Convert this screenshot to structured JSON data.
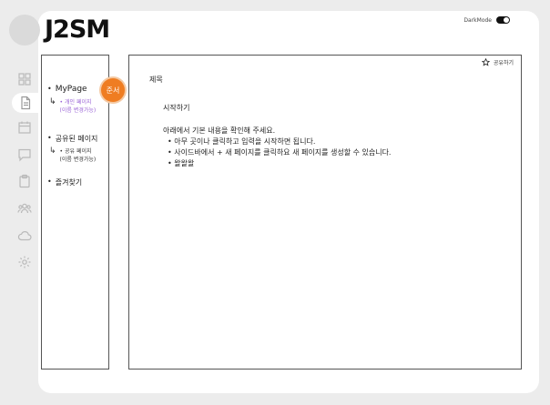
{
  "header": {
    "logo_text": "J2SM",
    "darkmode_label": "DarkMode",
    "darkmode_on": true
  },
  "rail": {
    "icons": [
      "grid-icon",
      "document-icon",
      "calendar-icon",
      "chat-icon",
      "clipboard-icon",
      "users-icon",
      "cloud-icon",
      "gear-icon"
    ],
    "active": "document-icon"
  },
  "sidebar": {
    "mypage": "MyPage",
    "personal_page": "개인 페이지",
    "personal_rename": "(이름 변경가능)",
    "shared_pages": "공유된 페이지",
    "shared_page": "공유 페이지",
    "shared_rename": "(이름 변경가능)",
    "favorites": "즐겨찾기"
  },
  "badge": {
    "label": "준서",
    "color": "#ef7d22"
  },
  "document": {
    "share_label": "공유하기",
    "title": "제목",
    "subtitle": "시작하기",
    "intro": "아래에서 기본 내용을 확인해 주세요.",
    "items": [
      "아무 곳이나 클릭하고 입력을 시작하면 됩니다.",
      "사이드바에서 + 새 페이지를 클릭하요 새 페이지를 생성할 수 있습니다.",
      "왈왈왈"
    ]
  },
  "colors": {
    "accent": "#9a63d6",
    "badge": "#ef7d22"
  }
}
